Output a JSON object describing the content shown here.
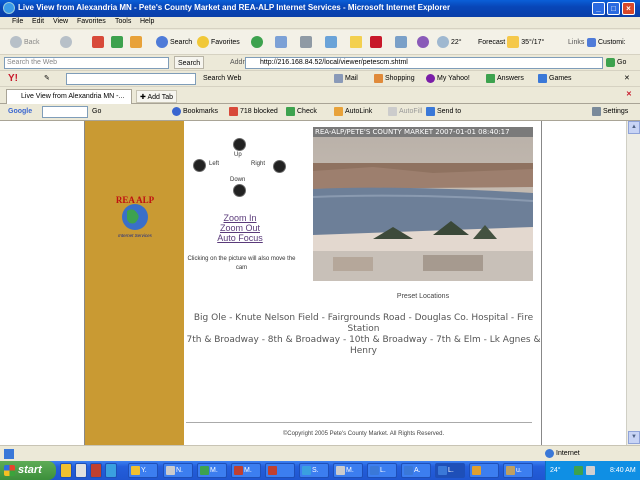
{
  "window": {
    "title": "Live View from Alexandria MN - Pete's County Market and REA-ALP Internet Services - Microsoft Internet Explorer"
  },
  "menu": [
    "File",
    "Edit",
    "View",
    "Favorites",
    "Tools",
    "Help"
  ],
  "toolbar": {
    "back": "Back",
    "search": "Search",
    "favorites": "Favorites",
    "temperature": "22°",
    "forecast": "Forecast",
    "forecast_value": "35°/17°",
    "links": "Links",
    "customize": "Customi:"
  },
  "address_row": {
    "search_placeholder": "Search the Web",
    "search_button": "Search",
    "address_label": "Address",
    "url": "http://216.168.84.52/local/viewer/petescm.shtml",
    "go": "Go"
  },
  "yahoo_toolbar": {
    "search_web": "Search Web",
    "mail": "Mail",
    "shopping": "Shopping",
    "my_yahoo": "My Yahoo!",
    "answers": "Answers",
    "games": "Games"
  },
  "tabs": {
    "active": "Live View from Alexandria MN -...",
    "add": "Add Tab"
  },
  "google_toolbar": {
    "label": "Google",
    "go": "Go",
    "bookmarks": "Bookmarks",
    "blocked": "718 blocked",
    "check": "Check",
    "autolink": "AutoLink",
    "autofill": "AutoFill",
    "send_to": "Send to",
    "settings": "Settings"
  },
  "page": {
    "logo_text": "REA ALP",
    "logo_subtext": "Internet Services",
    "controls": {
      "up": "Up",
      "left": "Left",
      "right": "Right",
      "down": "Down"
    },
    "zoom_in": "Zoom In",
    "zoom_out": "Zoom Out",
    "auto_focus": "Auto Focus",
    "hint": "Clicking on the picture will also move the cam",
    "camera_stamp": "REA-ALP/PETE'S COUNTY MARKET 2007-01-01 08:40:17",
    "preset_title": "Preset Locations",
    "presets_line1": "Big Ole - Knute Nelson Field - Fairgrounds Road - Douglas Co. Hospital - Fire Station",
    "presets_line2": "7th & Broadway - 8th & Broadway - 10th & Broadway - 7th & Elm - Lk Agnes & Henry",
    "copyright": "©Copyright 2005 Pete's County Market. All Rights Reserved."
  },
  "status": {
    "zone": "Internet"
  },
  "taskbar": {
    "start": "start",
    "buttons": [
      "N.",
      "M.",
      "M.",
      "S.",
      "M.",
      "L.",
      "A.",
      "L.",
      "u."
    ],
    "clock": "8:40 AM",
    "tray_temp": "24°"
  },
  "colors": {
    "gold": "#c99a33",
    "title_blue": "#0a5fd8",
    "link": "#5a3a7a"
  }
}
